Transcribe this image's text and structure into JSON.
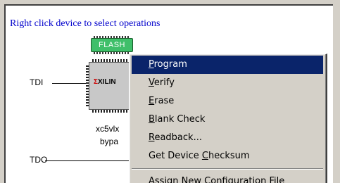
{
  "instruction": "Right click device to select operations",
  "signals": {
    "tdi": "TDI",
    "tdo": "TDO"
  },
  "flash_chip": {
    "label": "FLASH"
  },
  "fpga_chip": {
    "logo_text": "XILIN"
  },
  "device": {
    "name": "xc5vlx",
    "mode": "bypa"
  },
  "menu": {
    "items": [
      {
        "label": "Program",
        "accel_index": 0,
        "highlighted": true
      },
      {
        "label": "Verify",
        "accel_index": 0,
        "highlighted": false
      },
      {
        "label": "Erase",
        "accel_index": 0,
        "highlighted": false
      },
      {
        "label": "Blank Check",
        "accel_index": 0,
        "highlighted": false
      },
      {
        "label": "Readback...",
        "accel_index": 0,
        "highlighted": false
      },
      {
        "label": "Get Device Checksum",
        "accel_index": 11,
        "highlighted": false
      },
      {
        "label": "Assign New Configuration File",
        "accel_index": -1,
        "highlighted": false
      }
    ]
  },
  "colors": {
    "hint_text": "#0000cc",
    "menu_bg": "#d4d0c8",
    "menu_highlight": "#0a246a",
    "flash_chip": "#3fbf6a"
  }
}
